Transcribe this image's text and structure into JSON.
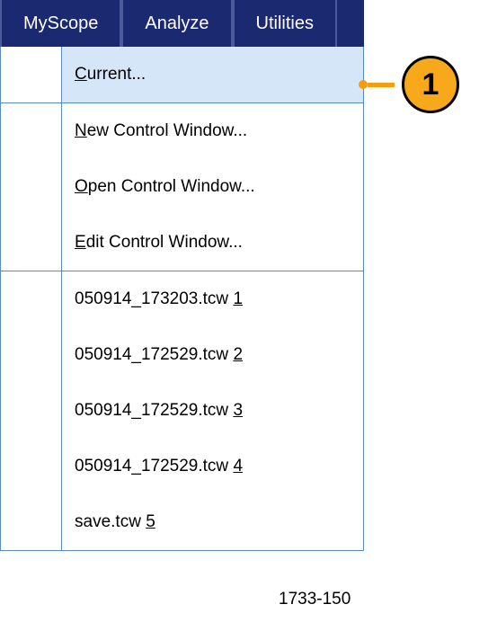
{
  "menubar": {
    "tabs": [
      {
        "label": "MyScope"
      },
      {
        "label": "Analyze"
      },
      {
        "label": "Utilities"
      }
    ]
  },
  "dropdown": {
    "sections": [
      {
        "items": [
          {
            "pre": "",
            "accel": "C",
            "post": "urrent...",
            "highlighted": true
          }
        ]
      },
      {
        "items": [
          {
            "pre": "",
            "accel": "N",
            "post": "ew Control Window...",
            "highlighted": false
          },
          {
            "pre": "",
            "accel": "O",
            "post": "pen Control Window...",
            "highlighted": false
          },
          {
            "pre": "",
            "accel": "E",
            "post": "dit Control Window...",
            "highlighted": false
          }
        ]
      },
      {
        "items": [
          {
            "pre": "050914_173203.tcw ",
            "accel": "1",
            "post": "",
            "highlighted": false
          },
          {
            "pre": "050914_172529.tcw ",
            "accel": "2",
            "post": "",
            "highlighted": false
          },
          {
            "pre": "050914_172529.tcw ",
            "accel": "3",
            "post": "",
            "highlighted": false
          },
          {
            "pre": "050914_172529.tcw ",
            "accel": "4",
            "post": "",
            "highlighted": false
          },
          {
            "pre": "save.tcw ",
            "accel": "5",
            "post": "",
            "highlighted": false
          }
        ]
      }
    ]
  },
  "callout": {
    "number": "1"
  },
  "figure_id": "1733-150"
}
